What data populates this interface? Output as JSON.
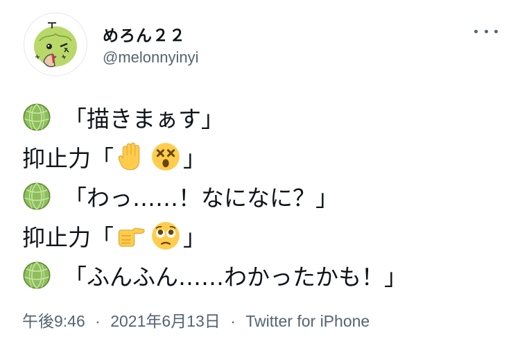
{
  "tweet": {
    "author": {
      "display_name": "めろん２２",
      "handle": "@melonnyinyi"
    },
    "lines": [
      {
        "speaker_icon": "melon-emoji",
        "text": "「描きまぁす」"
      },
      {
        "prefix": "抑止力「",
        "emojis": [
          "raised-hand-emoji",
          "dizzy-face-emoji"
        ],
        "suffix": "」"
      },
      {
        "speaker_icon": "melon-emoji",
        "text": "「わっ……！なになに？」"
      },
      {
        "prefix": "抑止力「",
        "emojis": [
          "pointing-hand-emoji",
          "face-holding-back-tears-emoji"
        ],
        "suffix": "」"
      },
      {
        "speaker_icon": "melon-emoji",
        "text": "「ふんふん……わかったかも！」"
      }
    ],
    "meta": {
      "time": "午後9:46",
      "separator": "·",
      "date": "2021年6月13日",
      "source": "Twitter for iPhone"
    }
  },
  "icons": {
    "more": "more-horizontal-icon",
    "avatar": "melon-character-avatar"
  },
  "colors": {
    "text": "#0f1419",
    "secondary": "#536471",
    "melon": "#7cb342",
    "emoji_yellow": "#ffcc4d"
  }
}
